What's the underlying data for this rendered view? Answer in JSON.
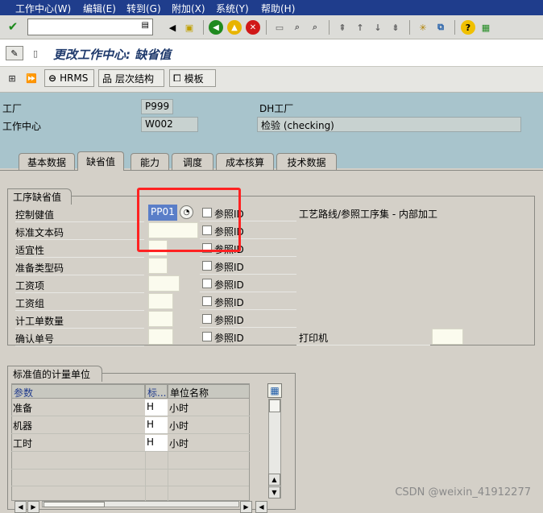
{
  "menu": [
    "工作中心(W)",
    "编辑(E)",
    "转到(G)",
    "附加(X)",
    "系统(Y)",
    "帮助(H)"
  ],
  "title": "更改工作中心: 缺省值",
  "app_toolbar": {
    "hrms": "HRMS",
    "hierarchy": "层次结构",
    "template": "模板"
  },
  "header": {
    "plant_label": "工厂",
    "plant_value": "P999",
    "plant_desc": "DH工厂",
    "wc_label": "工作中心",
    "wc_value": "W002",
    "wc_desc": "检验 (checking)"
  },
  "tabs": [
    "基本数据",
    "缺省值",
    "能力",
    "调度",
    "成本核算",
    "技术数据"
  ],
  "defaults_group": {
    "title": "工序缺省值",
    "fields": [
      {
        "label": "控制健值",
        "value": "PP01"
      },
      {
        "label": "标准文本码",
        "value": ""
      },
      {
        "label": "适宜性",
        "value": ""
      },
      {
        "label": "准备类型码",
        "value": ""
      },
      {
        "label": "工资项",
        "value": ""
      },
      {
        "label": "工资组",
        "value": ""
      },
      {
        "label": "计工单数量",
        "value": ""
      },
      {
        "label": "确认单号",
        "value": ""
      }
    ],
    "ref_label": "参照ID",
    "routing_note": "工艺路线/参照工序集 - 内部加工",
    "printer_label": "打印机"
  },
  "units_group": {
    "title": "标准值的计量单位",
    "columns": [
      "参数",
      "标...",
      "单位名称"
    ],
    "rows": [
      {
        "param": "准备",
        "unit": "H",
        "name": "小时"
      },
      {
        "param": "机器",
        "unit": "H",
        "name": "小时"
      },
      {
        "param": "工时",
        "unit": "H",
        "name": "小时"
      }
    ]
  },
  "watermark": "CSDN @weixin_41912277",
  "colors": {
    "menubar": "#1f3d8c",
    "header": "#a8c4cc",
    "highlight": "#ff2222"
  }
}
